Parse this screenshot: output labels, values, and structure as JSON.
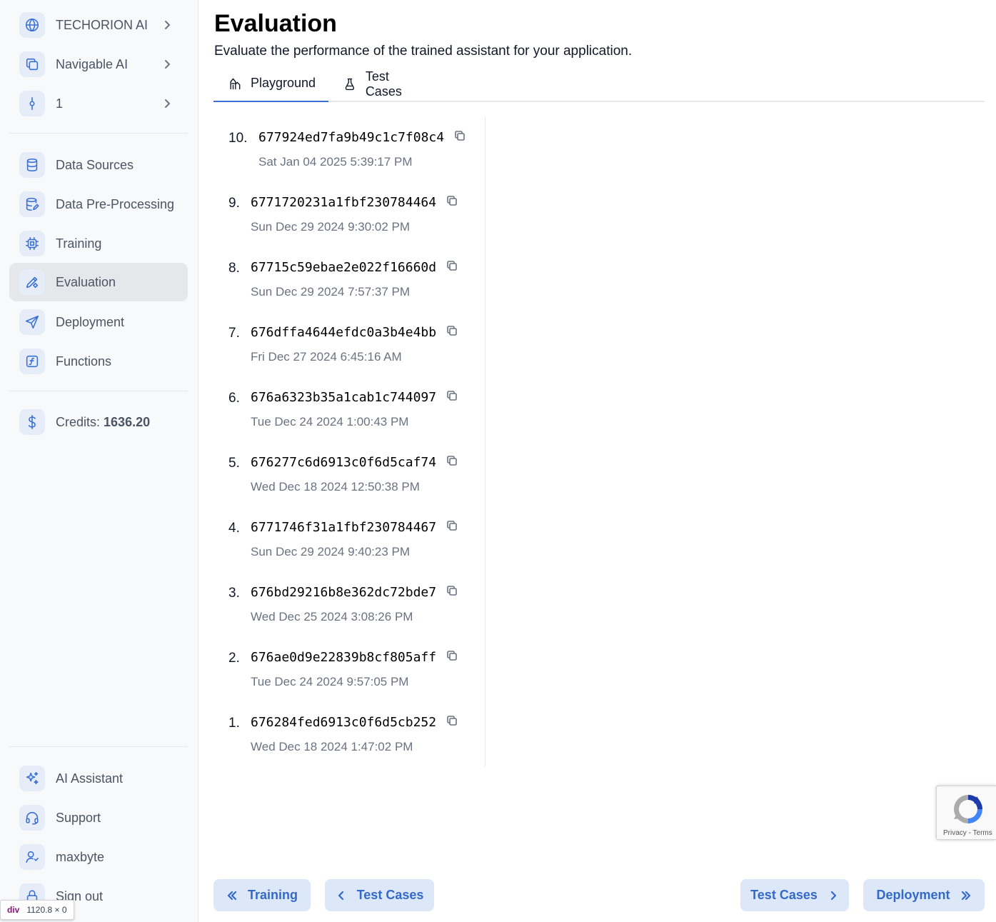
{
  "sidebar": {
    "top": [
      {
        "label": "TECHORION AI",
        "icon": "globe-icon"
      },
      {
        "label": "Navigable AI",
        "icon": "copy-icon"
      },
      {
        "label": "1",
        "icon": "git-commit-icon"
      }
    ],
    "nav": [
      {
        "label": "Data Sources",
        "icon": "database-icon"
      },
      {
        "label": "Data Pre-Processing",
        "icon": "database-edit-icon"
      },
      {
        "label": "Training",
        "icon": "cpu-icon"
      },
      {
        "label": "Evaluation",
        "icon": "pencil-ruler-icon",
        "active": true
      },
      {
        "label": "Deployment",
        "icon": "send-icon"
      },
      {
        "label": "Functions",
        "icon": "function-icon"
      }
    ],
    "credits": {
      "label": "Credits:",
      "value": "1636.20",
      "icon": "dollar-icon"
    },
    "bottom": [
      {
        "label": "AI Assistant",
        "icon": "sparkles-icon"
      },
      {
        "label": "Support",
        "icon": "headset-icon"
      },
      {
        "label": "maxbyte",
        "icon": "user-icon"
      },
      {
        "label": "Sign out",
        "icon": "lock-icon"
      }
    ]
  },
  "devtools_tooltip": {
    "tag": "div",
    "dimensions": "1120.8 × 0"
  },
  "header": {
    "title": "Evaluation",
    "subtitle": "Evaluate the performance of the trained assistant for your application."
  },
  "tabs": [
    {
      "label": "Playground",
      "icon": "playground-icon",
      "active": true
    },
    {
      "label": "Test Cases",
      "icon": "flask-icon",
      "active": false
    }
  ],
  "runs": [
    {
      "num": "10.",
      "id": "677924ed7fa9b49c1c7f08c4",
      "date": "Sat Jan 04 2025 5:39:17 PM"
    },
    {
      "num": "9.",
      "id": "6771720231a1fbf230784464",
      "date": "Sun Dec 29 2024 9:30:02 PM"
    },
    {
      "num": "8.",
      "id": "67715c59ebae2e022f16660d",
      "date": "Sun Dec 29 2024 7:57:37 PM"
    },
    {
      "num": "7.",
      "id": "676dffa4644efdc0a3b4e4bb",
      "date": "Fri Dec 27 2024 6:45:16 AM"
    },
    {
      "num": "6.",
      "id": "676a6323b35a1cab1c744097",
      "date": "Tue Dec 24 2024 1:00:43 PM"
    },
    {
      "num": "5.",
      "id": "676277c6d6913c0f6d5caf74",
      "date": "Wed Dec 18 2024 12:50:38 PM"
    },
    {
      "num": "4.",
      "id": "6771746f31a1fbf230784467",
      "date": "Sun Dec 29 2024 9:40:23 PM"
    },
    {
      "num": "3.",
      "id": "676bd29216b8e362dc72bde7",
      "date": "Wed Dec 25 2024 3:08:26 PM"
    },
    {
      "num": "2.",
      "id": "676ae0d9e22839b8cf805aff",
      "date": "Tue Dec 24 2024 9:57:05 PM"
    },
    {
      "num": "1.",
      "id": "676284fed6913c0f6d5cb252",
      "date": "Wed Dec 18 2024 1:47:02 PM"
    }
  ],
  "footer_nav": {
    "prev_section": "Training",
    "prev_tab": "Test Cases",
    "next_tab": "Test Cases",
    "next_section": "Deployment"
  },
  "recaptcha": {
    "privacy": "Privacy",
    "separator": " - ",
    "terms": "Terms"
  },
  "colors": {
    "accent": "#3b6fd4",
    "button_bg": "#dce8f8",
    "active_nav_bg": "#e5e7eb"
  }
}
